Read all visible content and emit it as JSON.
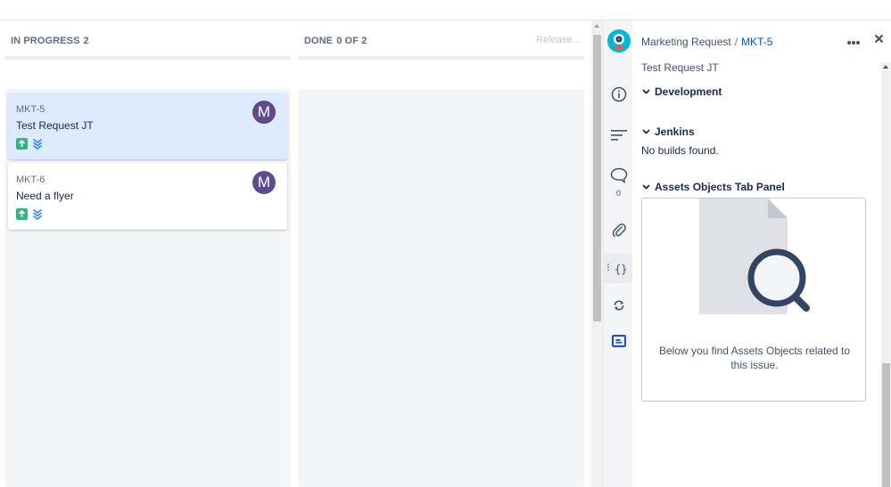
{
  "board": {
    "columns": [
      {
        "name": "IN PROGRESS",
        "count": "2"
      },
      {
        "name": "DONE",
        "count": "0 OF 2"
      }
    ],
    "release_label": "Release...",
    "cards": [
      {
        "key": "MKT-5",
        "summary": "Test Request JT",
        "avatar_initial": "M",
        "selected": true
      },
      {
        "key": "MKT-6",
        "summary": "Need a flyer",
        "avatar_initial": "M",
        "selected": false
      }
    ]
  },
  "rail": {
    "icons": [
      "project-avatar-icon",
      "info-icon",
      "activity-icon",
      "comment-icon",
      "attachment-icon",
      "code-icon",
      "sync-icon",
      "assets-icon"
    ],
    "comment_count": "0"
  },
  "panel": {
    "project_name": "Marketing Request",
    "separator": "/",
    "issue_key": "MKT-5",
    "summary": "Test Request JT",
    "sections": {
      "development": "Development",
      "jenkins": "Jenkins",
      "jenkins_text": "No builds found.",
      "assets": "Assets Objects Tab Panel",
      "assets_caption": "Below you find Assets Objects related to this issue."
    }
  },
  "colors": {
    "selected_card": "#deebff",
    "avatar": "#5e4b8b",
    "story": "#36b37e",
    "link": "#0052cc"
  }
}
